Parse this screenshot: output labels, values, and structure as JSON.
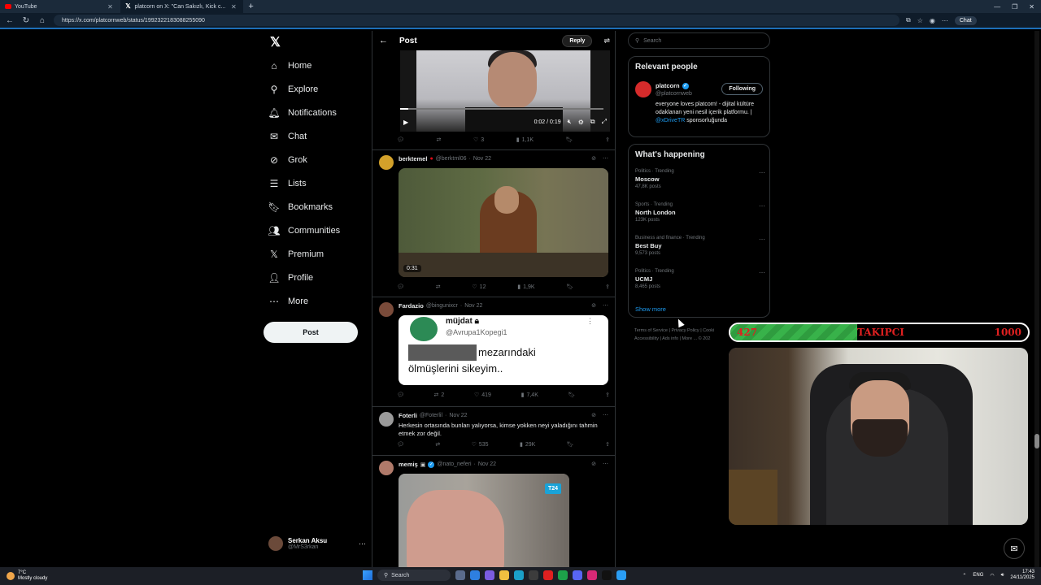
{
  "browser": {
    "tabs": [
      {
        "label": "YouTube",
        "active": false
      },
      {
        "label": "platcorn on X: \"Can Sakızlı, Kick c...",
        "active": true
      }
    ],
    "url": "https://x.com/platcornweb/status/1992322183088255090",
    "chat_label": "Chat"
  },
  "nav": {
    "items": [
      {
        "label": "Home",
        "icon": "home-icon"
      },
      {
        "label": "Explore",
        "icon": "search-icon"
      },
      {
        "label": "Notifications",
        "icon": "bell-icon"
      },
      {
        "label": "Chat",
        "icon": "mail-icon"
      },
      {
        "label": "Grok",
        "icon": "grok-icon"
      },
      {
        "label": "Lists",
        "icon": "list-icon"
      },
      {
        "label": "Bookmarks",
        "icon": "bookmark-icon"
      },
      {
        "label": "Communities",
        "icon": "people-icon"
      },
      {
        "label": "Premium",
        "icon": "x-icon"
      },
      {
        "label": "Profile",
        "icon": "person-icon"
      },
      {
        "label": "More",
        "icon": "more-icon"
      }
    ],
    "post_button": "Post",
    "account": {
      "name": "Serkan Aksu",
      "handle": "@MrS3rkan"
    }
  },
  "main": {
    "title": "Post",
    "reply_button": "Reply",
    "video1": {
      "time": "0:02 / 0:19",
      "progress": 0.04
    },
    "video1_actions": {
      "replies": "",
      "reposts": "",
      "likes": "3",
      "views": "1,1K"
    },
    "tweets": [
      {
        "name": "berktemel",
        "handle": "@berktml06",
        "date": "Nov 22",
        "media_duration": "0:31",
        "replies": "",
        "reposts": "",
        "likes": "12",
        "views": "1,9K"
      },
      {
        "name": "Fardazio",
        "handle": "@bingunixcr",
        "date": "Nov 22",
        "quote": {
          "name": "müjdat",
          "handle": "@Avrupa1Kopegi1",
          "line1": "mezarındaki",
          "line2": "ölmüşlerini sikeyim.."
        },
        "replies": "",
        "reposts": "2",
        "likes": "419",
        "views": "7,4K"
      },
      {
        "name": "Foterli",
        "handle": "@Foterlil",
        "date": "Nov 22",
        "text": "Herkesin ortasında bunları yalıyorsa, kimse yokken neyi yaladığını tahmin etmek zor değil.",
        "replies": "",
        "reposts": "",
        "likes": "535",
        "views": "29K"
      },
      {
        "name": "memiş",
        "handle": "@nato_neferi",
        "date": "Nov 22",
        "badge": "T24"
      }
    ]
  },
  "sidebar": {
    "search_placeholder": "Search",
    "relevant": {
      "title": "Relevant people",
      "name": "platcorn",
      "handle": "@platcornweb",
      "follow_label": "Following",
      "bio": "everyone loves platcorn! - dijital kültüre odaklanan yeni nesil içerik platformu. |",
      "bio_link": "@xDriveTR",
      "bio_end": "sponsorluğunda"
    },
    "happening": {
      "title": "What's happening",
      "trends": [
        {
          "category": "Politics · Trending",
          "name": "Moscow",
          "count": "47,8K posts"
        },
        {
          "category": "Sports · Trending",
          "name": "North London",
          "count": "123K posts"
        },
        {
          "category": "Business and finance · Trending",
          "name": "Best Buy",
          "count": "9,573 posts"
        },
        {
          "category": "Politics · Trending",
          "name": "UCMJ",
          "count": "8,465 posts"
        }
      ],
      "show_more": "Show more"
    },
    "footer": {
      "line1": "Terms of Service  |  Privacy Policy  |  Cooki",
      "line2": "Accessibility  |  Ads info  |  More ...  © 202"
    }
  },
  "overlay": {
    "counter": {
      "current": "427",
      "label": "TAKIPCI",
      "max": "1000",
      "fraction": 0.427
    }
  },
  "taskbar": {
    "temperature": "7°C",
    "weather": "Mostly cloudy",
    "search": "Search",
    "lang": "ENG",
    "time": "17:43",
    "date": "24/11/2025"
  },
  "colors": {
    "accent": "#1d9bf0",
    "counter_fill": "#38b24a",
    "counter_text": "#e02020"
  }
}
